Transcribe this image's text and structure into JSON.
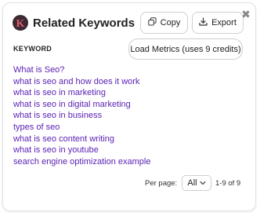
{
  "header": {
    "logo_letter": "K",
    "title": "Related Keywords",
    "copy_label": "Copy",
    "export_label": "Export",
    "close_glyph": "✖"
  },
  "toolbar": {
    "load_metrics_label": "Load Metrics (uses 9 credits)"
  },
  "table": {
    "column_header": "KEYWORD",
    "keywords": [
      "What is Seo?",
      "what is seo and how does it work",
      "what is seo in marketing",
      "what is seo in digital marketing",
      "what is seo in business",
      "types of seo",
      "what is seo content writing",
      "what is seo in youtube",
      "search engine optimization example"
    ]
  },
  "pagination": {
    "per_page_label": "Per page:",
    "per_page_value": "All",
    "range_text": "1-9 of 9"
  },
  "colors": {
    "link": "#5b21b6",
    "logo_bg": "#3b2a33",
    "logo_letter": "#e05a6a"
  }
}
